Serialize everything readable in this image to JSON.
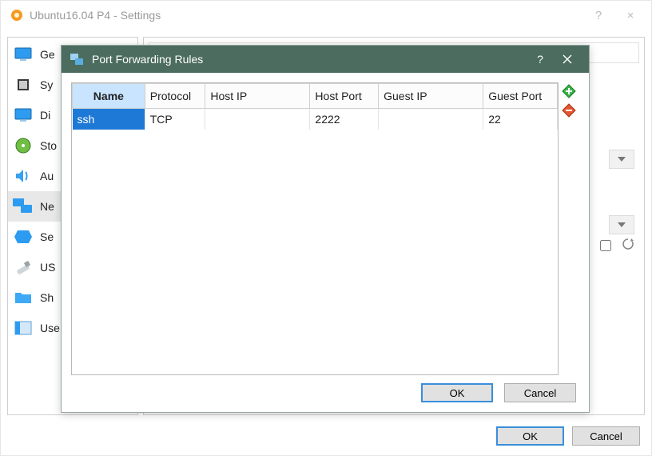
{
  "main": {
    "title": "Ubuntu16.04 P4 - Settings",
    "help": "?",
    "close": "×",
    "ok_label": "OK",
    "cancel_label": "Cancel"
  },
  "sidebar": {
    "items": [
      {
        "label": "Ge"
      },
      {
        "label": "Sy"
      },
      {
        "label": "Di"
      },
      {
        "label": "Sto"
      },
      {
        "label": "Au"
      },
      {
        "label": "Ne"
      },
      {
        "label": "Se"
      },
      {
        "label": "US"
      },
      {
        "label": "Sh"
      },
      {
        "label": "Use"
      }
    ]
  },
  "dialog": {
    "title": "Port Forwarding Rules",
    "help": "?",
    "close": "×",
    "ok_label": "OK",
    "cancel_label": "Cancel",
    "columns": {
      "name": "Name",
      "protocol": "Protocol",
      "host_ip": "Host IP",
      "host_port": "Host Port",
      "guest_ip": "Guest IP",
      "guest_port": "Guest Port"
    },
    "rows": [
      {
        "name": "ssh",
        "protocol": "TCP",
        "host_ip": "",
        "host_port": "2222",
        "guest_ip": "",
        "guest_port": "22"
      }
    ]
  }
}
